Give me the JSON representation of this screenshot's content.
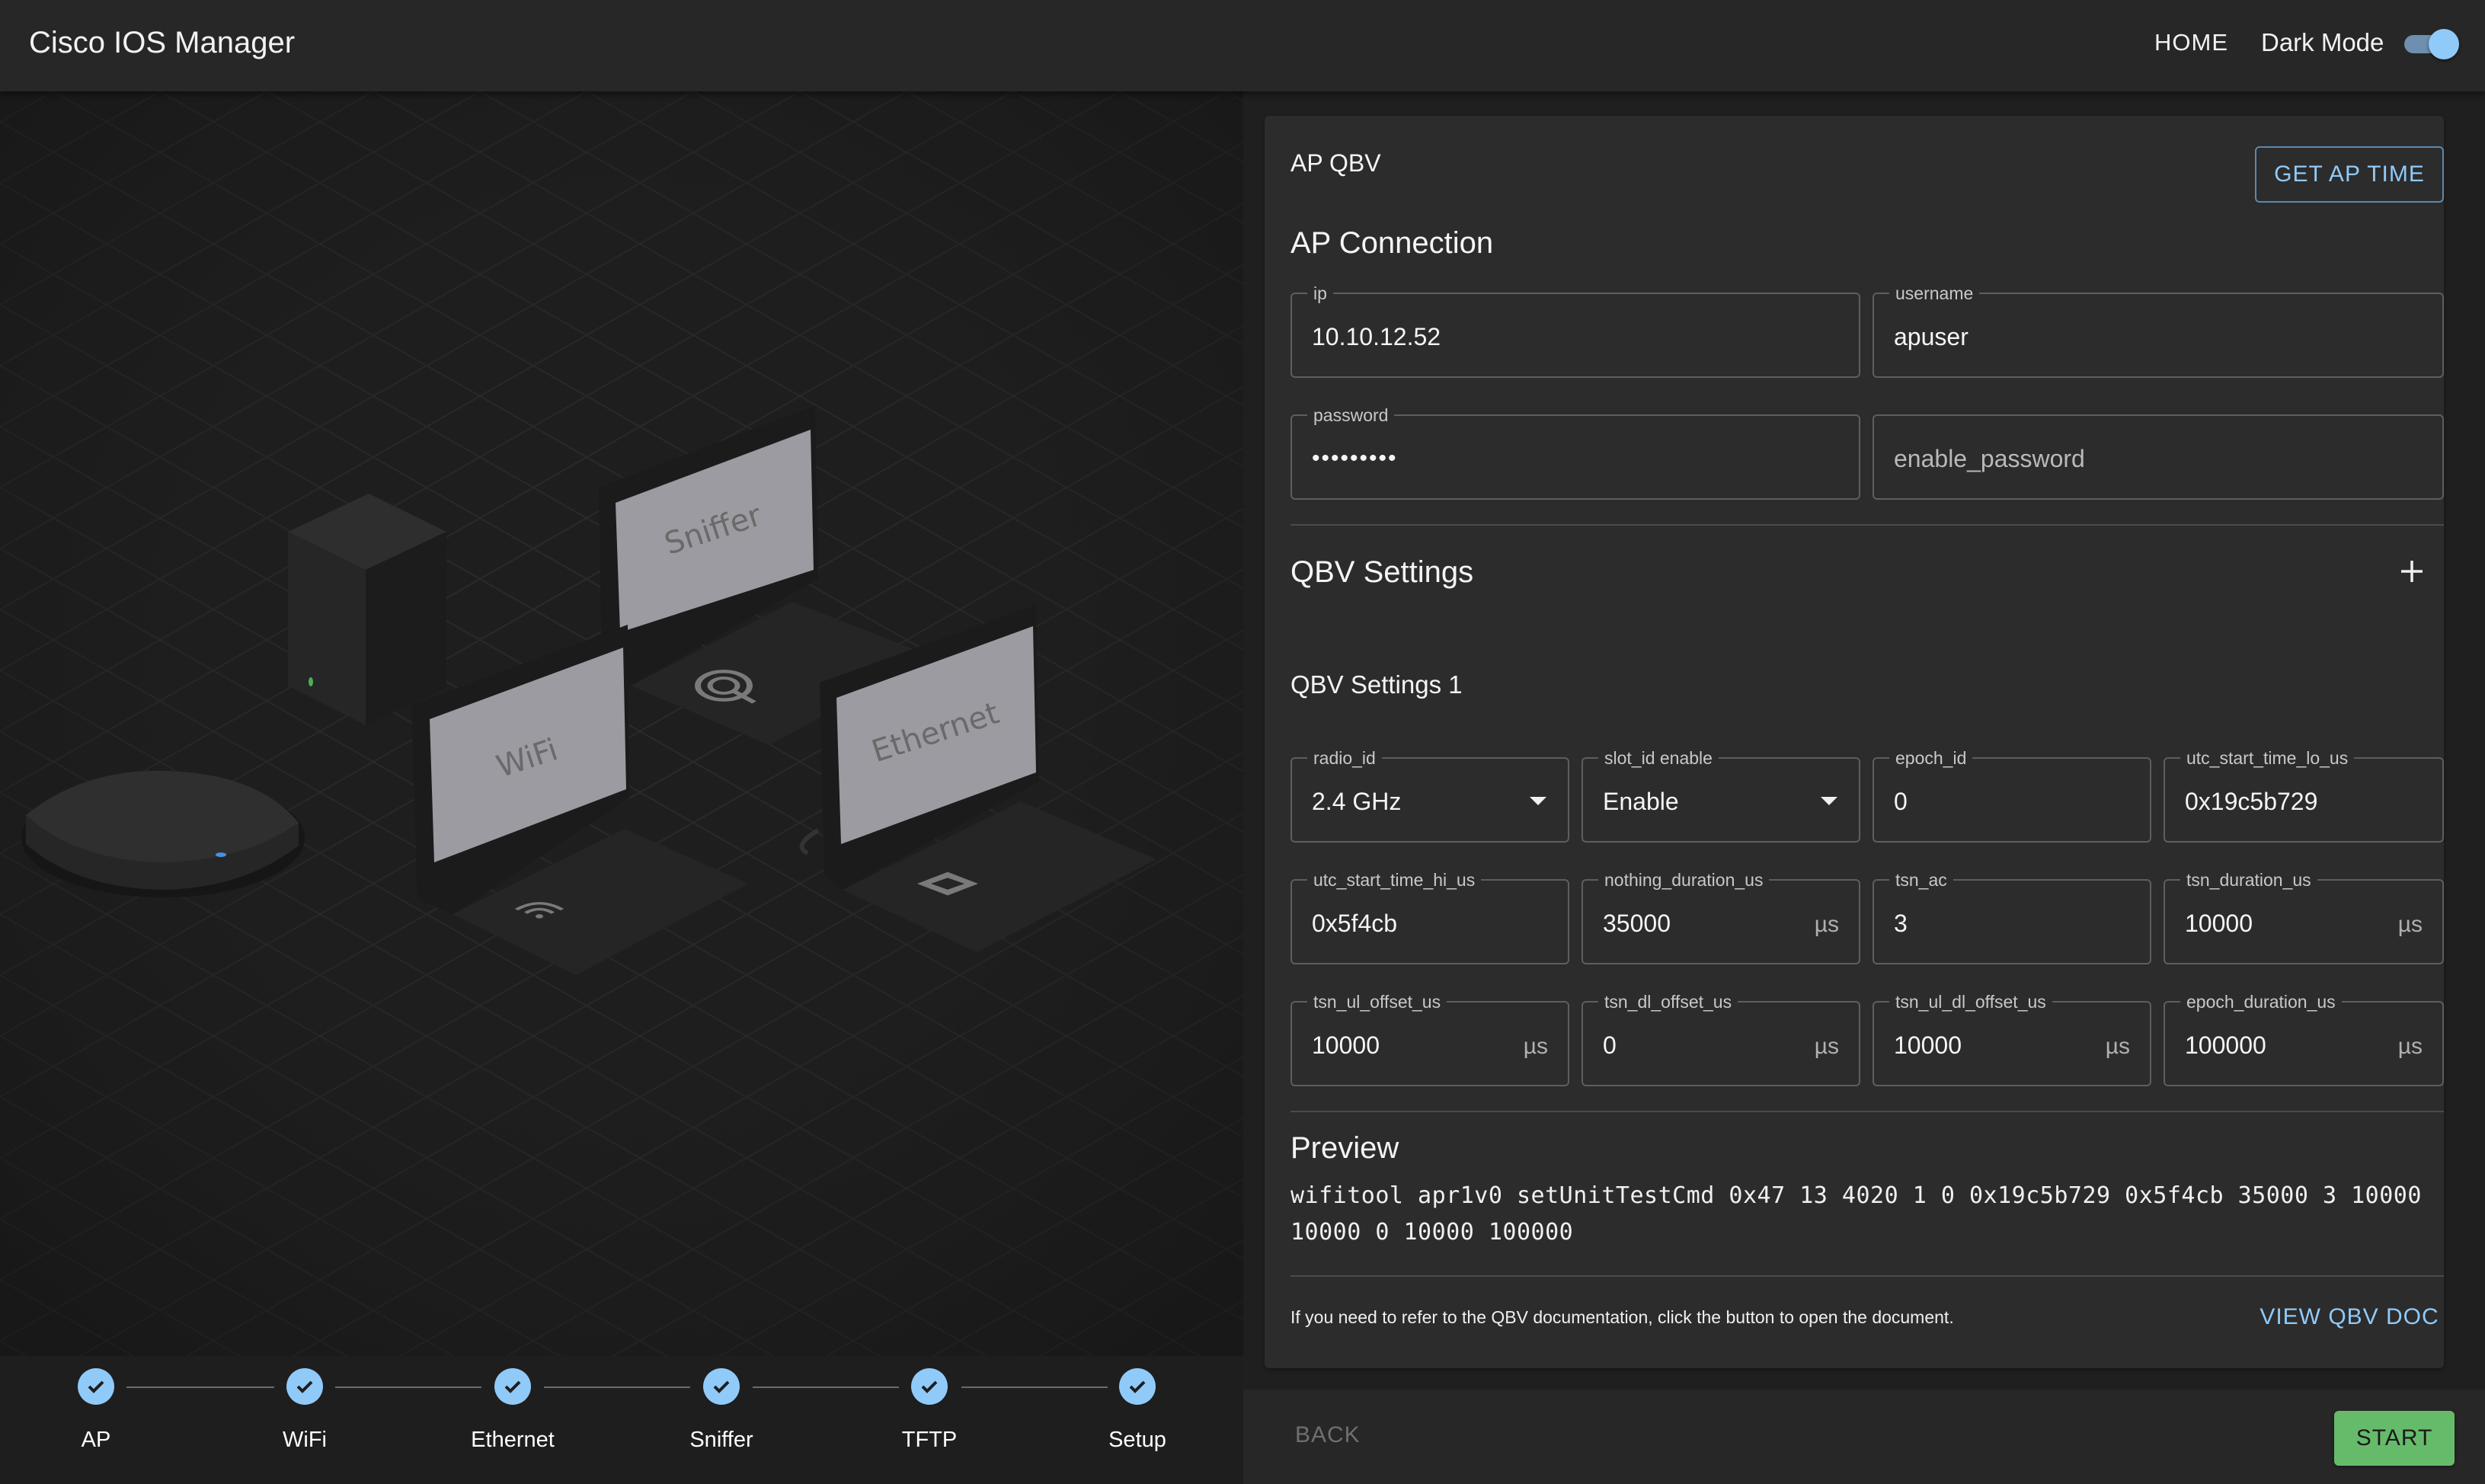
{
  "header": {
    "title": "Cisco IOS Manager",
    "home_label": "HOME",
    "dark_mode_label": "Dark Mode",
    "dark_mode_on": true
  },
  "scene": {
    "devices": [
      {
        "label": "Sniffer",
        "icon": "wifi-sniffer-icon"
      },
      {
        "label": "WiFi",
        "icon": "wifi-icon"
      },
      {
        "label": "Ethernet",
        "icon": "ethernet-port-icon"
      }
    ]
  },
  "stepper": {
    "steps": [
      {
        "label": "AP",
        "completed": true
      },
      {
        "label": "WiFi",
        "completed": true
      },
      {
        "label": "Ethernet",
        "completed": true
      },
      {
        "label": "Sniffer",
        "completed": true
      },
      {
        "label": "TFTP",
        "completed": true
      },
      {
        "label": "Setup",
        "completed": true
      }
    ]
  },
  "panel": {
    "title": "AP QBV",
    "get_time_label": "GET AP TIME",
    "connection": {
      "heading": "AP Connection",
      "ip": {
        "label": "ip",
        "value": "10.10.12.52"
      },
      "username": {
        "label": "username",
        "value": "apuser"
      },
      "password": {
        "label": "password",
        "value": "•••••••••"
      },
      "enable_password": {
        "placeholder": "enable_password"
      }
    },
    "qbv": {
      "heading": "QBV Settings",
      "group_title": "QBV Settings 1",
      "fields": {
        "radio_id": {
          "label": "radio_id",
          "value": "2.4 GHz"
        },
        "slot_id_enable": {
          "label": "slot_id enable",
          "value": "Enable"
        },
        "epoch_id": {
          "label": "epoch_id",
          "value": "0"
        },
        "utc_start_time_lo_us": {
          "label": "utc_start_time_lo_us",
          "value": "0x19c5b729"
        },
        "utc_start_time_hi_us": {
          "label": "utc_start_time_hi_us",
          "value": "0x5f4cb"
        },
        "nothing_duration_us": {
          "label": "nothing_duration_us",
          "value": "35000",
          "unit": "µs"
        },
        "tsn_ac": {
          "label": "tsn_ac",
          "value": "3"
        },
        "tsn_duration_us": {
          "label": "tsn_duration_us",
          "value": "10000",
          "unit": "µs"
        },
        "tsn_ul_offset_us": {
          "label": "tsn_ul_offset_us",
          "value": "10000",
          "unit": "µs"
        },
        "tsn_dl_offset_us": {
          "label": "tsn_dl_offset_us",
          "value": "0",
          "unit": "µs"
        },
        "tsn_ul_dl_offset_us": {
          "label": "tsn_ul_dl_offset_us",
          "value": "10000",
          "unit": "µs"
        },
        "epoch_duration_us": {
          "label": "epoch_duration_us",
          "value": "100000",
          "unit": "µs"
        }
      }
    },
    "preview": {
      "heading": "Preview",
      "command": "wifitool apr1v0 setUnitTestCmd 0x47 13 4020 1 0 0x19c5b729 0x5f4cb 35000 3 10000 10000 0 10000 100000"
    },
    "doc_note": "If you need to refer to the QBV documentation, click the button to open the document.",
    "view_doc_label": "VIEW QBV DOC"
  },
  "actions": {
    "back_label": "BACK",
    "start_label": "START"
  },
  "colors": {
    "accent": "#90caf9",
    "start_button": "#66bb6a",
    "background": "#1f1f1f",
    "panel": "#2c2c2c"
  }
}
